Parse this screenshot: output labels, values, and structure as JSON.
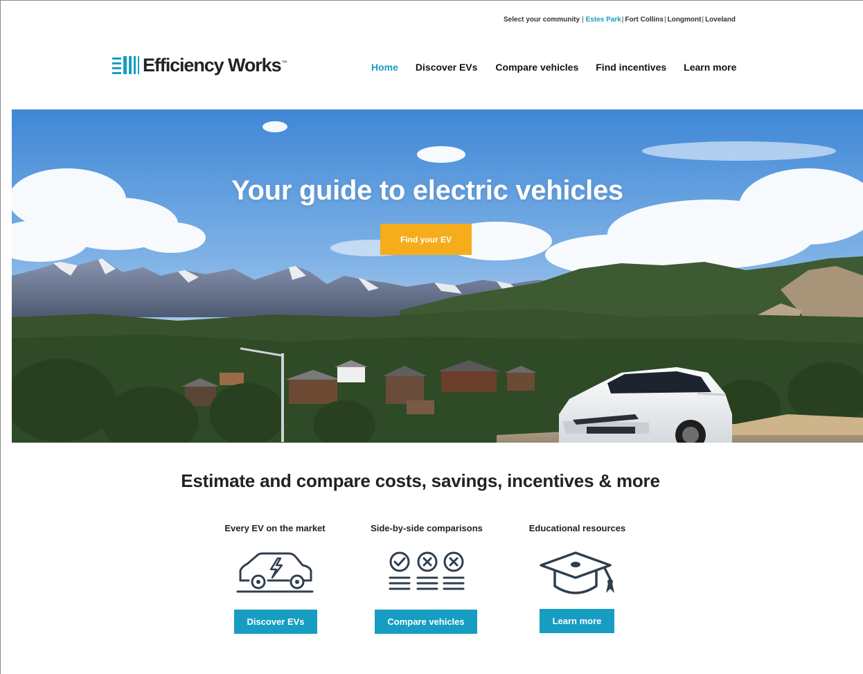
{
  "community": {
    "prompt": "Select your community",
    "options": [
      {
        "label": "Estes Park",
        "active": true
      },
      {
        "label": "Fort Collins",
        "active": false
      },
      {
        "label": "Longmont",
        "active": false
      },
      {
        "label": "Loveland",
        "active": false
      }
    ]
  },
  "logo": {
    "text": "Efficiency Works",
    "tm": "™",
    "icon": "striped-bars-logo-mark"
  },
  "nav": {
    "items": [
      {
        "label": "Home",
        "active": true
      },
      {
        "label": "Discover EVs",
        "active": false
      },
      {
        "label": "Compare vehicles",
        "active": false
      },
      {
        "label": "Find incentives",
        "active": false
      },
      {
        "label": "Learn more",
        "active": false
      }
    ]
  },
  "hero": {
    "title": "Your guide to electric vehicles",
    "cta": "Find your EV"
  },
  "features": {
    "title": "Estimate and compare costs, savings, incentives & more",
    "items": [
      {
        "label": "Every EV on the market",
        "icon": "electric-car-icon",
        "button": "Discover EVs"
      },
      {
        "label": "Side-by-side comparisons",
        "icon": "comparison-checklist-icon",
        "button": "Compare vehicles"
      },
      {
        "label": "Educational resources",
        "icon": "graduation-cap-icon",
        "button": "Learn more"
      }
    ]
  },
  "colors": {
    "accent": "#1a9bc4",
    "button": "#179dc2",
    "cta": "#f5ad1c"
  }
}
